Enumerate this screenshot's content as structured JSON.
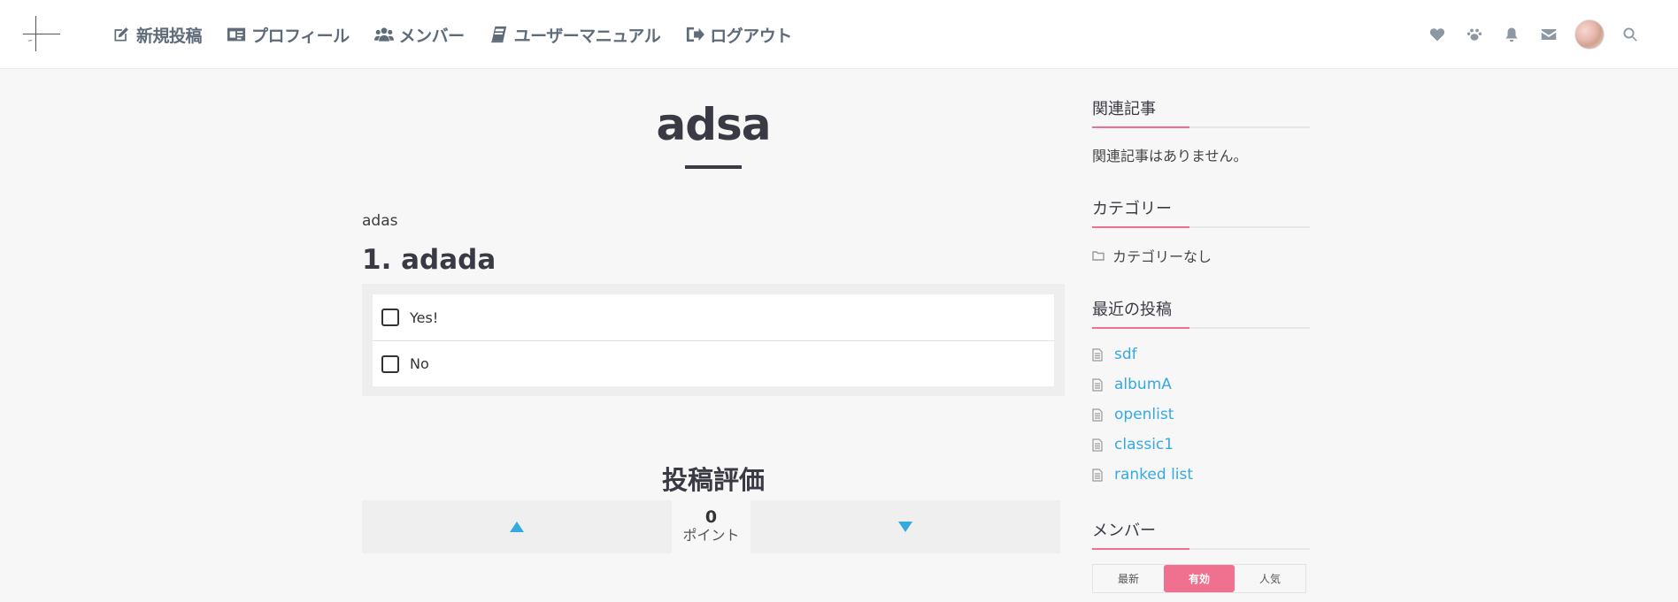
{
  "header": {
    "nav": [
      {
        "label": "新規投稿",
        "icon": "edit-icon"
      },
      {
        "label": "プロフィール",
        "icon": "profile-card-icon"
      },
      {
        "label": "メンバー",
        "icon": "users-icon"
      },
      {
        "label": "ユーザーマニュアル",
        "icon": "book-icon"
      },
      {
        "label": "ログアウト",
        "icon": "logout-icon"
      }
    ],
    "right_icons": [
      "heart-icon",
      "paw-icon",
      "bell-icon",
      "mail-icon",
      "avatar",
      "search-icon"
    ]
  },
  "post": {
    "title": "adsa",
    "body": "adas",
    "question": "1. adada",
    "options": [
      "Yes!",
      "No"
    ]
  },
  "rating": {
    "title": "投稿評価",
    "score": "0",
    "unit": "ポイント"
  },
  "sidebar": {
    "related": {
      "title": "関連記事",
      "empty": "関連記事はありません。"
    },
    "category": {
      "title": "カテゴリー",
      "none": "カテゴリーなし"
    },
    "recent": {
      "title": "最近の投稿",
      "posts": [
        "sdf",
        "albumA",
        "openlist",
        "classic1",
        "ranked list"
      ]
    },
    "members": {
      "title": "メンバー",
      "tabs": [
        "最新",
        "有効",
        "人気"
      ],
      "active_tab": "有効"
    }
  },
  "colors": {
    "accent": "#f0708f",
    "link": "#36a9e1",
    "nav_text": "#5f6b78"
  }
}
